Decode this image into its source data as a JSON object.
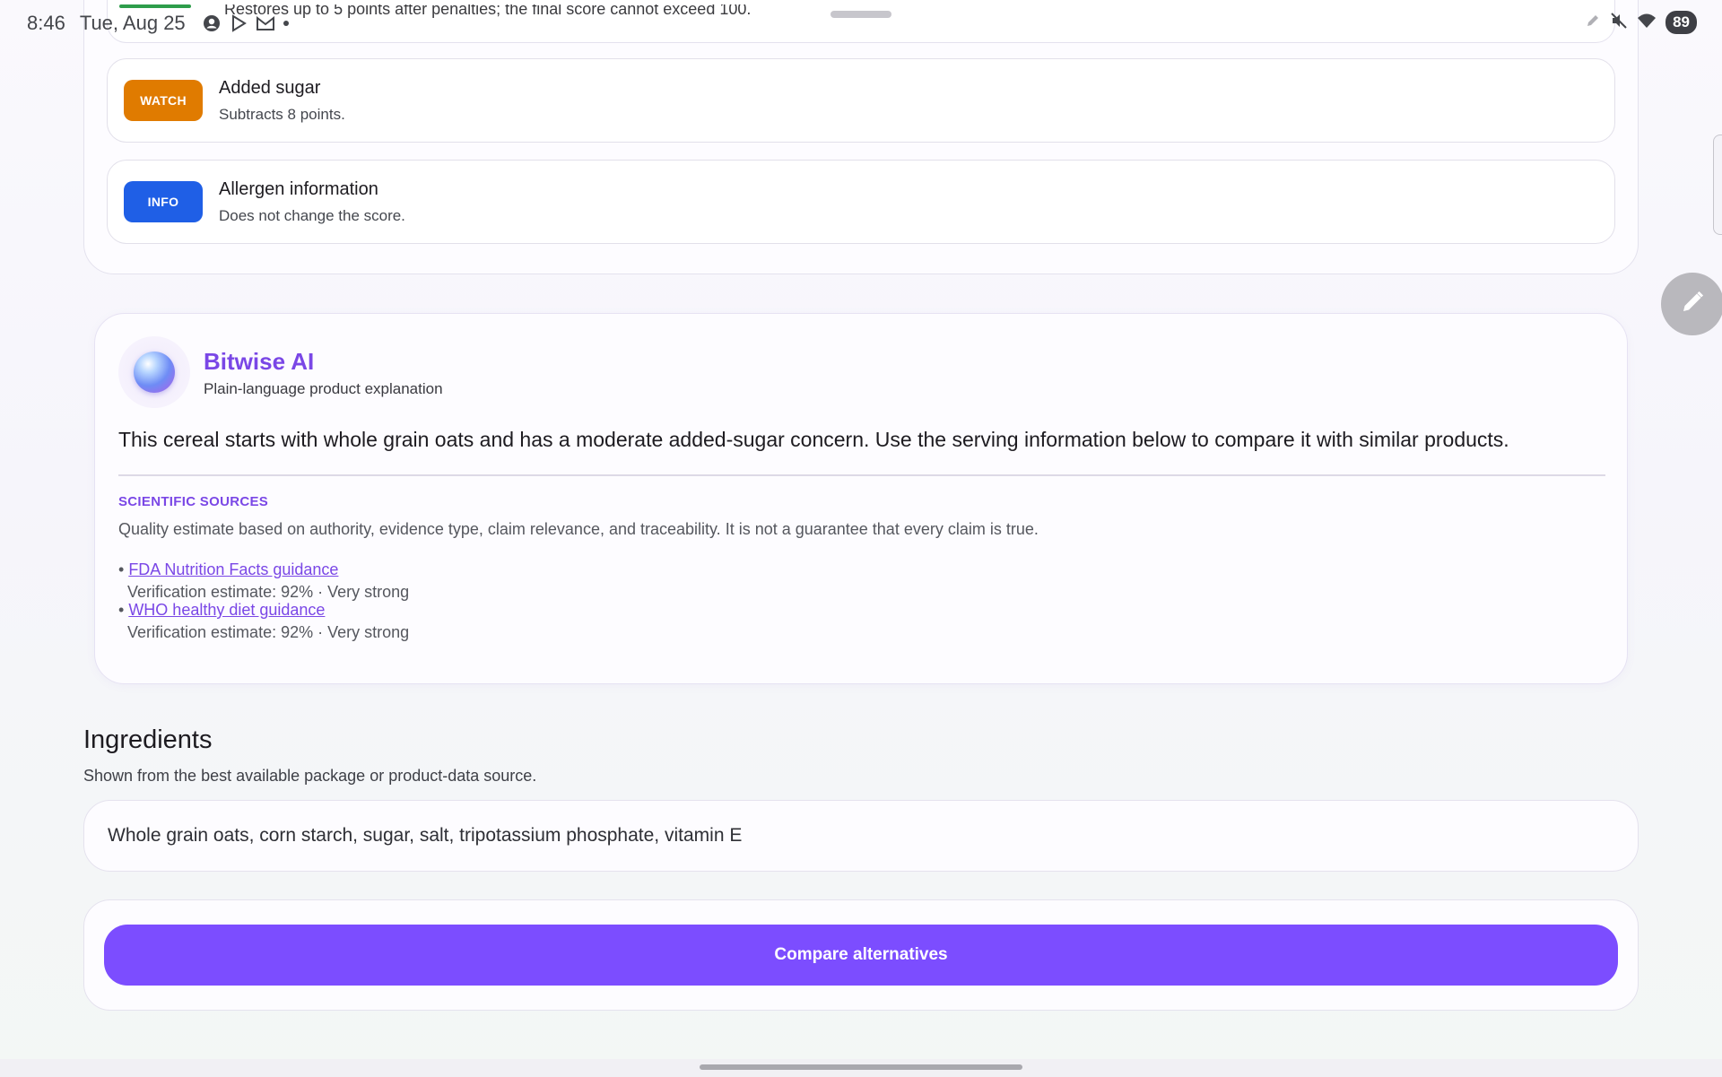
{
  "status_bar": {
    "time": "8:46",
    "date": "Tue, Aug 25",
    "battery": "89",
    "clipped_text": "Restores up to 5 points after penalties; the final score cannot exceed 100."
  },
  "penalties": [
    {
      "badge": "WATCH",
      "badge_color": "#e07b00",
      "title": "Added sugar",
      "subtitle": "Subtracts 8 points."
    },
    {
      "badge": "INFO",
      "badge_color": "#1f5fe6",
      "title": "Allergen information",
      "subtitle": "Does not change the score."
    }
  ],
  "ai": {
    "title": "Bitwise AI",
    "subtitle": "Plain-language product explanation",
    "body": "This cereal starts with whole grain oats and has a moderate added-sugar concern. Use the serving information below to compare it with similar products.",
    "sources_heading": "SCIENTIFIC SOURCES",
    "sources_desc": "Quality estimate based on authority, evidence type, claim relevance, and traceability. It is not a guarantee that every claim is true.",
    "sources": [
      {
        "name": "FDA Nutrition Facts guidance",
        "meta": "Verification estimate: 92% · Very strong"
      },
      {
        "name": "WHO healthy diet guidance",
        "meta": "Verification estimate: 92% · Very strong"
      }
    ],
    "accent": "#7a47e6"
  },
  "ingredients": {
    "title": "Ingredients",
    "subtitle": "Shown from the best available package or product-data source.",
    "text": "Whole grain oats, corn starch, sugar, salt, tripotassium phosphate, vitamin E"
  },
  "cta": {
    "label": "Compare alternatives",
    "color": "#7c4dff"
  }
}
